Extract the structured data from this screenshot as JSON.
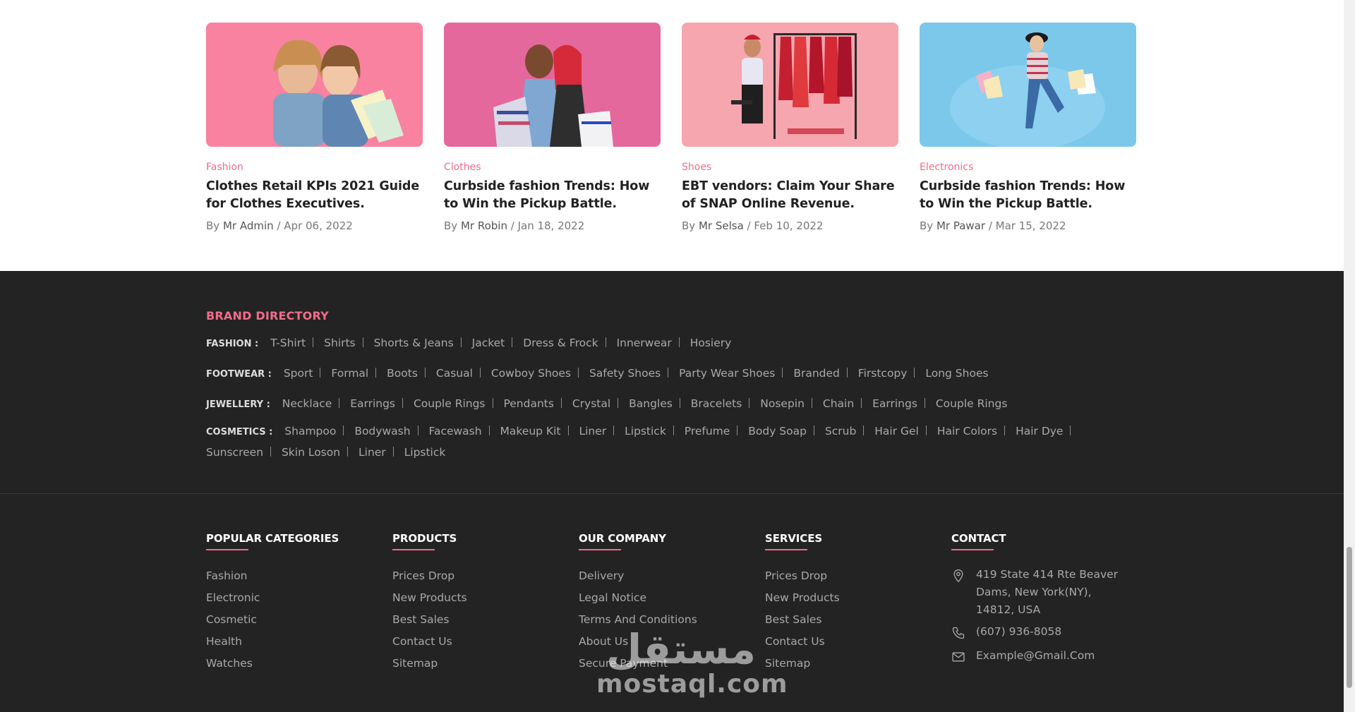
{
  "posts": [
    {
      "category": "Fashion",
      "title": "Clothes Retail KPIs 2021 Guide for Clothes Executives.",
      "by": "By",
      "author": "Mr Admin",
      "sep": "/",
      "date": "Apr 06, 2022",
      "bg": "#f47b97"
    },
    {
      "category": "Clothes",
      "title": "Curbside fashion Trends: How to Win the Pickup Battle.",
      "by": "By",
      "author": "Mr Robin",
      "sep": "/",
      "date": "Jan 18, 2022",
      "bg": "#e4689b"
    },
    {
      "category": "Shoes",
      "title": "EBT vendors: Claim Your Share of SNAP Online Revenue.",
      "by": "By",
      "author": "Mr Selsa",
      "sep": "/",
      "date": "Feb 10, 2022",
      "bg": "#f5a6ae"
    },
    {
      "category": "Electronics",
      "title": "Curbside fashion Trends: How to Win the Pickup Battle.",
      "by": "By",
      "author": "Mr Pawar",
      "sep": "/",
      "date": "Mar 15, 2022",
      "bg": "#7cc8ea"
    }
  ],
  "brand_directory": {
    "title": "BRAND DIRECTORY",
    "rows": [
      {
        "label": "FASHION :",
        "items": [
          "T-Shirt",
          "Shirts",
          "Shorts & Jeans",
          "Jacket",
          "Dress & Frock",
          "Innerwear",
          "Hosiery"
        ]
      },
      {
        "label": "FOOTWEAR :",
        "items": [
          "Sport",
          "Formal",
          "Boots",
          "Casual",
          "Cowboy Shoes",
          "Safety Shoes",
          "Party Wear Shoes",
          "Branded",
          "Firstcopy",
          "Long Shoes"
        ]
      },
      {
        "label": "JEWELLERY :",
        "items": [
          "Necklace",
          "Earrings",
          "Couple Rings",
          "Pendants",
          "Crystal",
          "Bangles",
          "Bracelets",
          "Nosepin",
          "Chain",
          "Earrings",
          "Couple Rings"
        ]
      },
      {
        "label": "COSMETICS :",
        "items": [
          "Shampoo",
          "Bodywash",
          "Facewash",
          "Makeup Kit",
          "Liner",
          "Lipstick",
          "Prefume",
          "Body Soap",
          "Scrub",
          "Hair Gel",
          "Hair Colors",
          "Hair Dye",
          "Sunscreen",
          "Skin Loson",
          "Liner",
          "Lipstick"
        ]
      }
    ]
  },
  "columns": [
    {
      "title": "POPULAR CATEGORIES",
      "links": [
        "Fashion",
        "Electronic",
        "Cosmetic",
        "Health",
        "Watches"
      ]
    },
    {
      "title": "PRODUCTS",
      "links": [
        "Prices Drop",
        "New Products",
        "Best Sales",
        "Contact Us",
        "Sitemap"
      ]
    },
    {
      "title": "OUR COMPANY",
      "links": [
        "Delivery",
        "Legal Notice",
        "Terms And Conditions",
        "About Us",
        "Secure Payment"
      ]
    },
    {
      "title": "SERVICES",
      "links": [
        "Prices Drop",
        "New Products",
        "Best Sales",
        "Contact Us",
        "Sitemap"
      ]
    }
  ],
  "contact": {
    "title": "CONTACT",
    "address": "419 State 414 Rte Beaver Dams, New York(NY), 14812, USA",
    "phone": "(607) 936-8058",
    "email": "Example@Gmail.Com",
    "icons": [
      "location-pin-icon",
      "phone-icon",
      "mail-icon"
    ]
  },
  "watermark": {
    "arabic": "مستقل",
    "latin": "mostaql.com"
  },
  "colors": {
    "accent": "#f06d8a",
    "footer_bg": "#232323",
    "link": "#a9a9a9"
  }
}
